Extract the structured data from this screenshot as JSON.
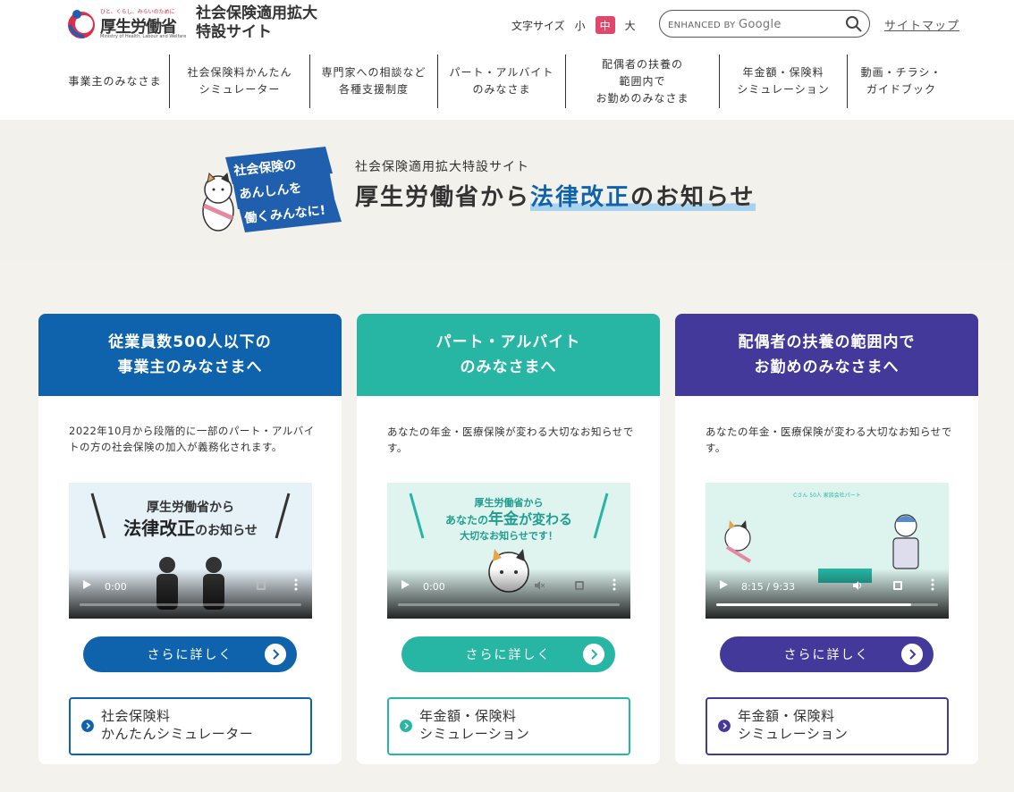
{
  "header": {
    "logo_tagline": "ひと、くらし、みらいのために",
    "logo_text": "厚生労働省",
    "logo_sub": "Ministry of Health, Labour and Welfare",
    "site_title_line1": "社会保険適用拡大",
    "site_title_line2": "特設サイト",
    "font_size_label": "文字サイズ",
    "font_sizes": [
      "小",
      "中",
      "大"
    ],
    "search_placeholder_prefix": "ENHANCED BY",
    "search_placeholder_brand": "Google",
    "sitemap_label": "サイトマップ"
  },
  "nav": [
    {
      "label": "事業主のみなさま"
    },
    {
      "label": "社会保険料かんたん\nシミュレーター"
    },
    {
      "label": "専門家への相談など\n各種支援制度"
    },
    {
      "label": "パート・アルバイト\nのみなさま"
    },
    {
      "label": "配偶者の扶養の\n範囲内で\nお勤めのみなさま"
    },
    {
      "label": "年金額・保険料\nシミュレーション"
    },
    {
      "label": "動画・チラシ・\nガイドブック"
    }
  ],
  "hero": {
    "badge_lines": [
      "社会保険の",
      "あんしんを",
      "働くみんなに!"
    ],
    "subtitle": "社会保険適用拡大特設サイト",
    "title_before": "厚生労働省から",
    "title_highlight": "法律改正",
    "title_after": "のお知らせ"
  },
  "cards": [
    {
      "title": "従業員数500人以下の\n事業主のみなさまへ",
      "color": "#0f63ac",
      "text": "2022年10月から段階的に一部のパート・アルバイトの方の社会保険の加入が義務化されます。",
      "video_line1": "厚生労働省から",
      "video_line2_hl": "法律改正",
      "video_line2_rest": "のお知らせ",
      "video_time": "0:00",
      "video_progress": 0,
      "more_label": "さらに詳しく",
      "link_label": "社会保険料\nかんたんシミュレーター"
    },
    {
      "title": "パート・アルバイト\nのみなさまへ",
      "color": "#27b5a4",
      "text": "あなたの年金・医療保険が変わる大切なお知らせです。",
      "video_line1": "厚生労働省から",
      "video_line2_pre": "あなたの",
      "video_line2_hl": "年金",
      "video_line2_rest": "が変わる",
      "video_line3": "大切なお知らせです！",
      "video_time": "0:00",
      "video_progress": 0,
      "more_label": "さらに詳しく",
      "link_label": "年金額・保険料\nシミュレーション"
    },
    {
      "title": "配偶者の扶養の範囲内で\nお勤めのみなさまへ",
      "color": "#43399b",
      "text": "あなたの年金・医療保険が変わる大切なお知らせです。",
      "video_top": "Cさん 50人 家族会社パート",
      "video_time": "8:15 / 9:33",
      "video_progress": 0.88,
      "more_label": "さらに詳しく",
      "link_label": "年金額・保険料\nシミュレーション"
    }
  ]
}
